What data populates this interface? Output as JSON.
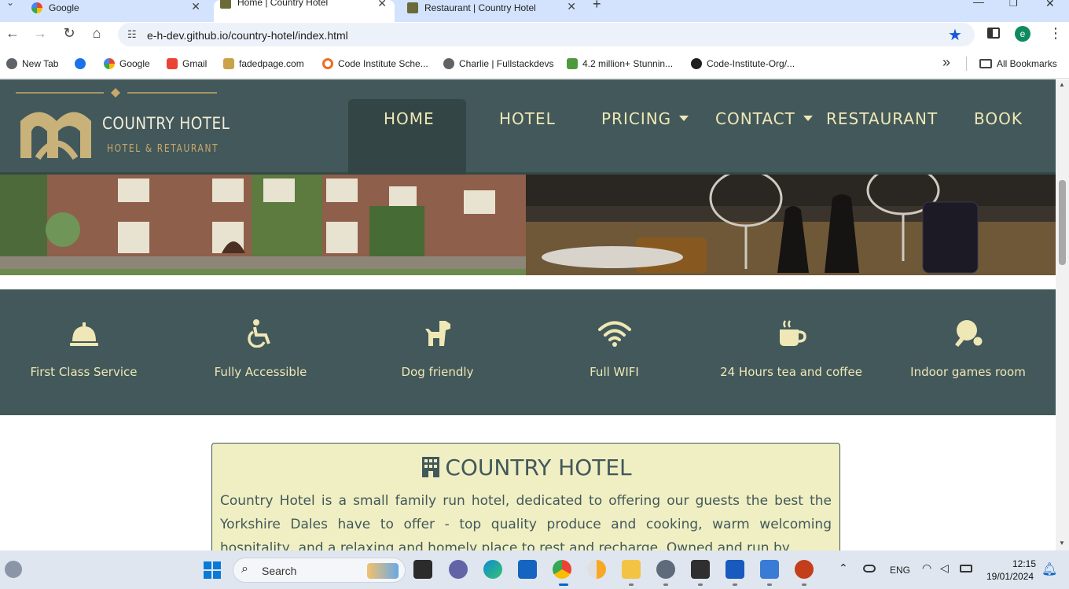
{
  "browser": {
    "tabs": [
      {
        "title": "Google",
        "active": false
      },
      {
        "title": "Home | Country Hotel",
        "active": true
      },
      {
        "title": "Restaurant | Country Hotel",
        "active": false
      }
    ],
    "new_tab_symbol": "+",
    "url": "e-h-dev.github.io/country-hotel/index.html",
    "profile_initial": "e",
    "bookmarks": [
      {
        "label": "New Tab",
        "icon": "globe-icon",
        "color": "#5f6368"
      },
      {
        "label": "",
        "icon": "settings-star-icon",
        "color": "#1a73e8"
      },
      {
        "label": "Google",
        "icon": "google-icon",
        "color": "#4285f4"
      },
      {
        "label": "Gmail",
        "icon": "gmail-icon",
        "color": "#ea4335"
      },
      {
        "label": "fadedpage.com",
        "icon": "fp-icon",
        "color": "#8b6b2b"
      },
      {
        "label": "Code Institute Sche...",
        "icon": "ring-icon",
        "color": "#f06a22"
      },
      {
        "label": "Charlie | Fullstackdevs",
        "icon": "globe-icon",
        "color": "#5f6368"
      },
      {
        "label": "4.2 million+ Stunnin...",
        "icon": "px-icon",
        "color": "#4f9a3c"
      },
      {
        "label": "Code-Institute-Org/...",
        "icon": "github-icon",
        "color": "#1f1f1f"
      }
    ],
    "all_bookmarks": "All Bookmarks",
    "more_symbol": "»"
  },
  "site": {
    "logo": {
      "name": "COUNTRY HOTEL",
      "tagline": "HOTEL & RETAURANT"
    },
    "nav": [
      {
        "label": "HOME",
        "active": true,
        "dropdown": false
      },
      {
        "label": "HOTEL",
        "active": false,
        "dropdown": false
      },
      {
        "label": "PRICING",
        "active": false,
        "dropdown": true
      },
      {
        "label": "CONTACT",
        "active": false,
        "dropdown": true
      },
      {
        "label": "RESTAURANT",
        "active": false,
        "dropdown": false
      },
      {
        "label": "BOOK",
        "active": false,
        "dropdown": false
      }
    ],
    "features": [
      {
        "label": "First Class Service",
        "icon": "bell-icon"
      },
      {
        "label": "Fully Accessible",
        "icon": "wheelchair-icon"
      },
      {
        "label": "Dog friendly",
        "icon": "dog-icon"
      },
      {
        "label": "Full WIFI",
        "icon": "wifi-icon"
      },
      {
        "label": "24 Hours tea and coffee",
        "icon": "mug-icon"
      },
      {
        "label": "Indoor games room",
        "icon": "table-tennis-icon"
      }
    ],
    "about": {
      "title": "COUNTRY HOTEL",
      "body": "Country Hotel is a small family run hotel, dedicated to offering our guests the best the Yorkshire Dales have to offer - top quality produce and cooking, warm welcoming hospitality, and a relaxing and homely place to rest and recharge. Owned and run by"
    },
    "colors": {
      "primary": "#42585a",
      "accent": "#efe7b5",
      "card": "#f0efc3"
    }
  },
  "taskbar": {
    "search_placeholder": "Search",
    "language": "ENG",
    "time": "12:15",
    "date": "19/01/2024"
  }
}
